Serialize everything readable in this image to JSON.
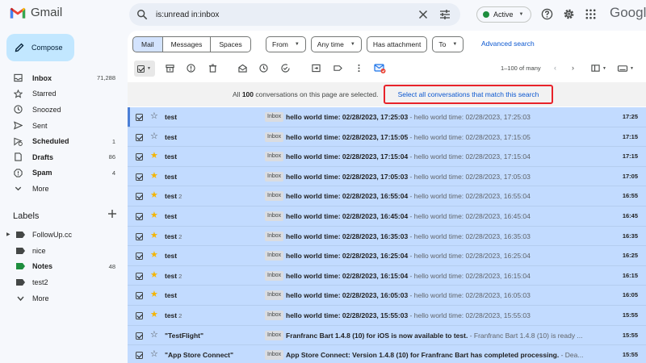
{
  "app": {
    "name": "Gmail"
  },
  "search": {
    "query": "is:unread in:inbox"
  },
  "status": {
    "label": "Active",
    "color": "#1e8e3e"
  },
  "brand_word": "Google",
  "compose": {
    "label": "Compose"
  },
  "nav": [
    {
      "label": "Inbox",
      "count": "71,288",
      "icon": "inbox-icon",
      "bold": true
    },
    {
      "label": "Starred",
      "count": "",
      "icon": "star-icon",
      "bold": false
    },
    {
      "label": "Snoozed",
      "count": "",
      "icon": "clock-icon",
      "bold": false
    },
    {
      "label": "Sent",
      "count": "",
      "icon": "send-icon",
      "bold": false
    },
    {
      "label": "Scheduled",
      "count": "1",
      "icon": "scheduled-icon",
      "bold": true
    },
    {
      "label": "Drafts",
      "count": "86",
      "icon": "draft-icon",
      "bold": true
    },
    {
      "label": "Spam",
      "count": "4",
      "icon": "spam-icon",
      "bold": true
    },
    {
      "label": "More",
      "count": "",
      "icon": "chevron-down-icon",
      "bold": false
    }
  ],
  "labels": {
    "title": "Labels",
    "items": [
      {
        "label": "FollowUp.cc",
        "count": "",
        "color": "#444746",
        "expandable": true,
        "bold": false
      },
      {
        "label": "nice",
        "count": "",
        "color": "#444746",
        "expandable": false,
        "bold": false
      },
      {
        "label": "Notes",
        "count": "48",
        "color": "#1e8e3e",
        "expandable": false,
        "bold": true
      },
      {
        "label": "test2",
        "count": "",
        "color": "#444746",
        "expandable": false,
        "bold": false
      },
      {
        "label": "More",
        "count": "",
        "color": "",
        "expandable": false,
        "bold": false
      }
    ]
  },
  "tabs": [
    "Mail",
    "Messages",
    "Spaces"
  ],
  "filters": [
    {
      "label": "From",
      "dropdown": true
    },
    {
      "label": "Any time",
      "dropdown": true
    },
    {
      "label": "Has attachment",
      "dropdown": false
    },
    {
      "label": "To",
      "dropdown": true
    }
  ],
  "advanced_search": "Advanced search",
  "pager": {
    "range": "1–100 of many"
  },
  "banner": {
    "prefix": "All ",
    "count": "100",
    "suffix": " conversations on this page are selected.",
    "link": "Select all conversations that match this search"
  },
  "inbox_tag": "Inbox",
  "rows": [
    {
      "sender": "test",
      "n": "",
      "starred": false,
      "subject": "hello world time: 02/28/2023, 17:25:03",
      "snippet": " - hello world time: 02/28/2023, 17:25:03",
      "time": "17:25"
    },
    {
      "sender": "test",
      "n": "",
      "starred": false,
      "subject": "hello world time: 02/28/2023, 17:15:05",
      "snippet": " - hello world time: 02/28/2023, 17:15:05",
      "time": "17:15"
    },
    {
      "sender": "test",
      "n": "",
      "starred": true,
      "subject": "hello world time: 02/28/2023, 17:15:04",
      "snippet": " - hello world time: 02/28/2023, 17:15:04",
      "time": "17:15"
    },
    {
      "sender": "test",
      "n": "",
      "starred": true,
      "subject": "hello world time: 02/28/2023, 17:05:03",
      "snippet": " - hello world time: 02/28/2023, 17:05:03",
      "time": "17:05"
    },
    {
      "sender": "test",
      "n": "2",
      "starred": true,
      "subject": "hello world time: 02/28/2023, 16:55:04",
      "snippet": " - hello world time: 02/28/2023, 16:55:04",
      "time": "16:55"
    },
    {
      "sender": "test",
      "n": "",
      "starred": true,
      "subject": "hello world time: 02/28/2023, 16:45:04",
      "snippet": " - hello world time: 02/28/2023, 16:45:04",
      "time": "16:45"
    },
    {
      "sender": "test",
      "n": "2",
      "starred": true,
      "subject": "hello world time: 02/28/2023, 16:35:03",
      "snippet": " - hello world time: 02/28/2023, 16:35:03",
      "time": "16:35"
    },
    {
      "sender": "test",
      "n": "",
      "starred": true,
      "subject": "hello world time: 02/28/2023, 16:25:04",
      "snippet": " - hello world time: 02/28/2023, 16:25:04",
      "time": "16:25"
    },
    {
      "sender": "test",
      "n": "2",
      "starred": true,
      "subject": "hello world time: 02/28/2023, 16:15:04",
      "snippet": " - hello world time: 02/28/2023, 16:15:04",
      "time": "16:15"
    },
    {
      "sender": "test",
      "n": "",
      "starred": true,
      "subject": "hello world time: 02/28/2023, 16:05:03",
      "snippet": " - hello world time: 02/28/2023, 16:05:03",
      "time": "16:05"
    },
    {
      "sender": "test",
      "n": "2",
      "starred": true,
      "subject": "hello world time: 02/28/2023, 15:55:03",
      "snippet": " - hello world time: 02/28/2023, 15:55:03",
      "time": "15:55"
    },
    {
      "sender": "\"TestFlight\"",
      "n": "",
      "starred": false,
      "subject": "Franfranc Bart 1.4.8 (10) for iOS is now available to test.",
      "snippet": " - Franfranc Bart 1.4.8 (10) is ready ...",
      "time": "15:55"
    },
    {
      "sender": "\"App Store Connect\"",
      "n": "",
      "starred": false,
      "subject": "App Store Connect: Version 1.4.8 (10) for Franfranc Bart has completed processing.",
      "snippet": " - Dea...",
      "time": "15:55"
    }
  ]
}
